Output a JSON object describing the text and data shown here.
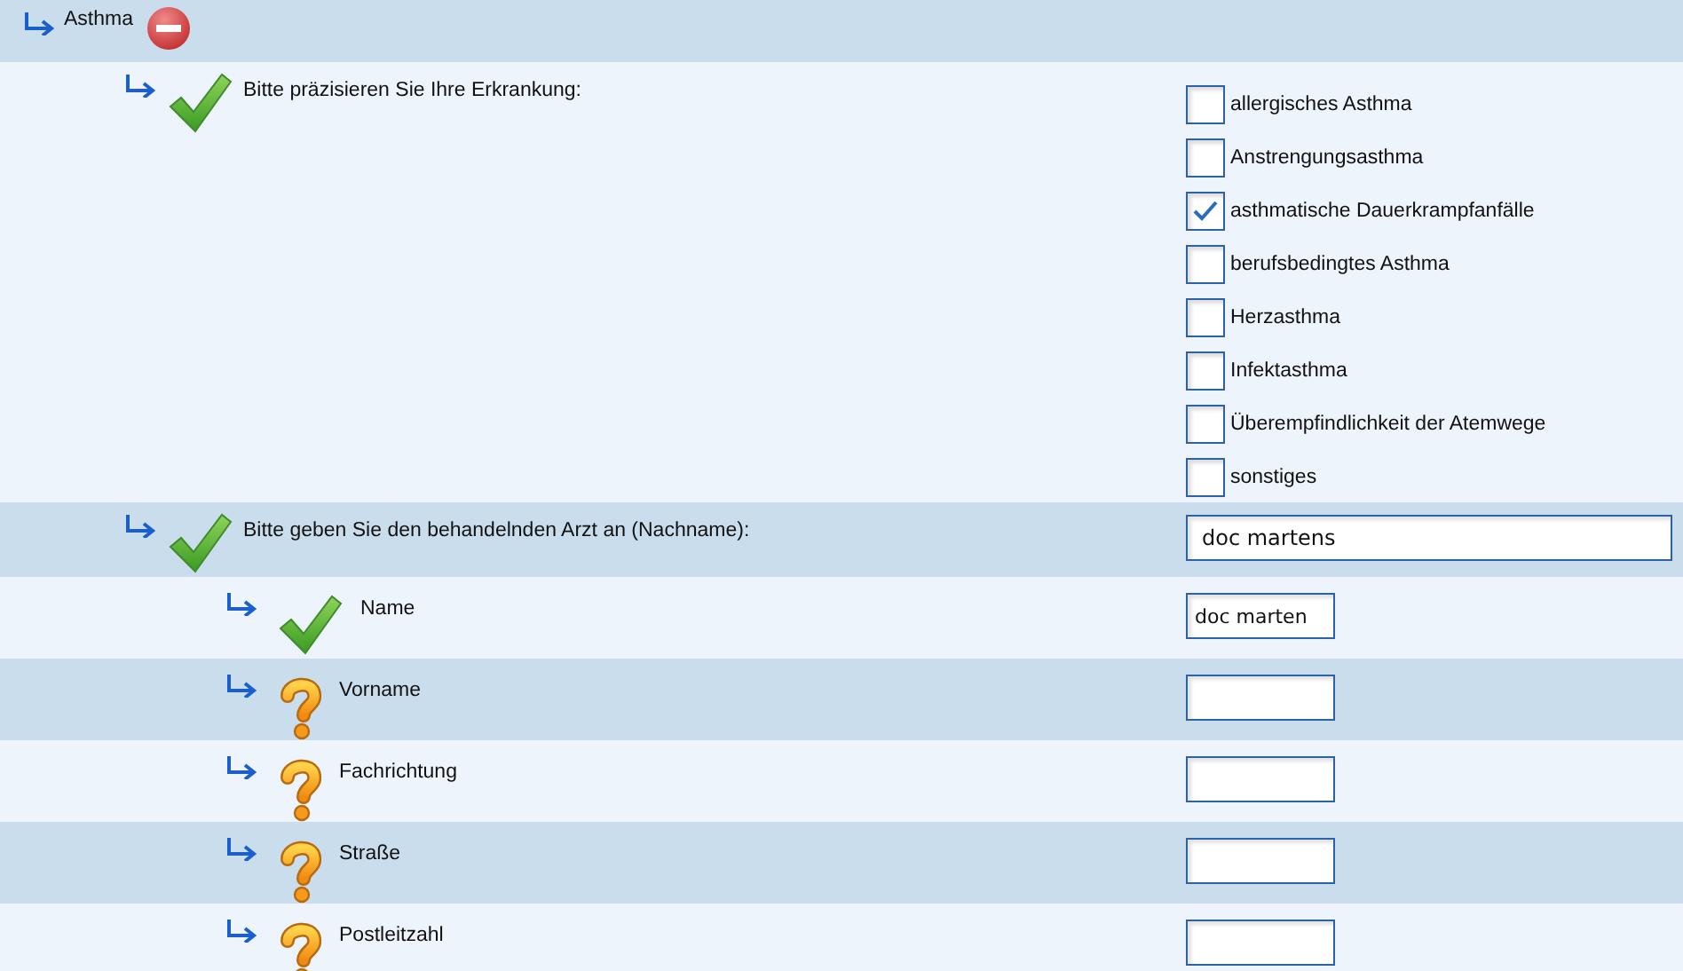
{
  "items": [
    {
      "label": "Asthma",
      "invalid": true,
      "kind": "header",
      "children": [
        {
          "label": "Bitte präzisieren Sie Ihre Erkrankung:",
          "answered": true,
          "kind": "checkboxes",
          "options": [
            {
              "label": "allergisches Asthma",
              "checked": false
            },
            {
              "label": "Anstrengungsasthma",
              "checked": false
            },
            {
              "label": "asthmatische Dauerkrampfanfälle",
              "checked": true
            },
            {
              "label": "berufsbedingtes Asthma",
              "checked": false
            },
            {
              "label": "Herzasthma",
              "checked": false
            },
            {
              "label": "Infektasthma",
              "checked": false
            },
            {
              "label": "Überempfindlichkeit der Atemwege",
              "checked": false
            },
            {
              "label": "sonstiges",
              "checked": false
            }
          ]
        },
        {
          "label": "Bitte geben Sie den behandelnden Arzt an (Nachname):",
          "answered": true,
          "kind": "long_text",
          "value": "doc martens",
          "children": [
            {
              "label": "Name",
              "answered": true,
              "kind": "short_text",
              "value": "doc marten"
            },
            {
              "label": "Vorname",
              "answered": false,
              "kind": "short_text"
            },
            {
              "label": "Fachrichtung",
              "answered": false,
              "kind": "short_text"
            },
            {
              "label": "Straße",
              "answered": false,
              "kind": "short_text"
            },
            {
              "label": "Postleitzahl",
              "answered": false,
              "kind": "short_text"
            }
          ]
        }
      ]
    }
  ]
}
